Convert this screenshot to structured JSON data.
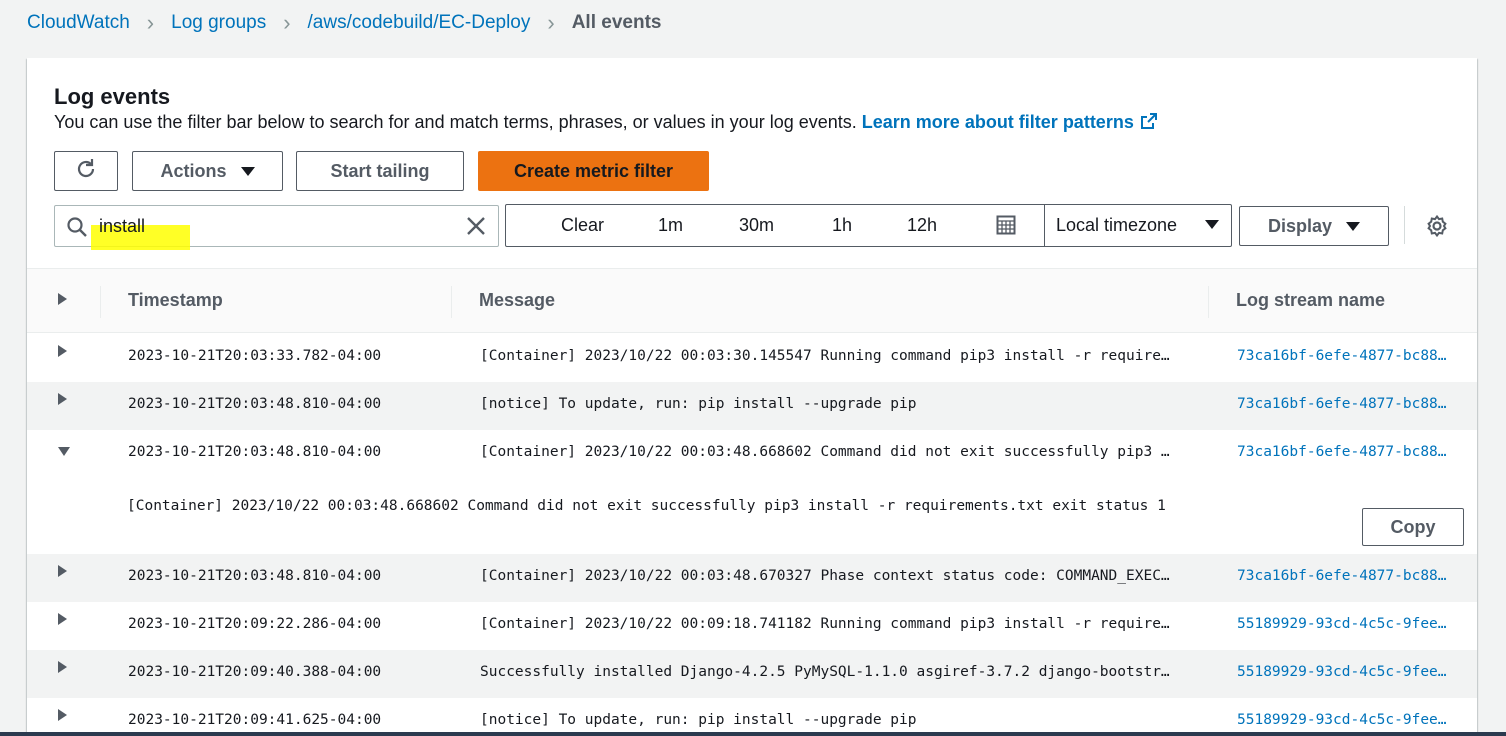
{
  "breadcrumb": {
    "items": [
      "CloudWatch",
      "Log groups",
      "/aws/codebuild/EC-Deploy"
    ],
    "current": "All events"
  },
  "panel": {
    "title": "Log events",
    "description": "You can use the filter bar below to search for and match terms, phrases, or values in your log events.",
    "learn_more": "Learn more about filter patterns"
  },
  "toolbar": {
    "actions_label": "Actions",
    "tailing_label": "Start tailing",
    "metric_label": "Create metric filter",
    "search_value": "install",
    "range": [
      "Clear",
      "1m",
      "30m",
      "1h",
      "12h"
    ],
    "timezone": "Local timezone",
    "display_label": "Display"
  },
  "columns": {
    "timestamp": "Timestamp",
    "message": "Message",
    "stream": "Log stream name"
  },
  "rows": [
    {
      "ts": "2023-10-21T20:03:33.782-04:00",
      "msg": "[Container] 2023/10/22 00:03:30.145547 Running command pip3 install -r require…",
      "stream": "73ca16bf-6efe-4877-bc88…"
    },
    {
      "ts": "2023-10-21T20:03:48.810-04:00",
      "msg": "[notice] To update, run: pip install --upgrade pip",
      "stream": "73ca16bf-6efe-4877-bc88…"
    },
    {
      "ts": "2023-10-21T20:03:48.810-04:00",
      "msg": "[Container] 2023/10/22 00:03:48.668602 Command did not exit successfully pip3 …",
      "stream": "73ca16bf-6efe-4877-bc88…"
    },
    {
      "ts": "2023-10-21T20:03:48.810-04:00",
      "msg": "[Container] 2023/10/22 00:03:48.670327 Phase context status code: COMMAND_EXEC…",
      "stream": "73ca16bf-6efe-4877-bc88…"
    },
    {
      "ts": "2023-10-21T20:09:22.286-04:00",
      "msg": "[Container] 2023/10/22 00:09:18.741182 Running command pip3 install -r require…",
      "stream": "55189929-93cd-4c5c-9fee…"
    },
    {
      "ts": "2023-10-21T20:09:40.388-04:00",
      "msg": "Successfully installed Django-4.2.5 PyMySQL-1.1.0 asgiref-3.7.2 django-bootstr…",
      "stream": "55189929-93cd-4c5c-9fee…"
    },
    {
      "ts": "2023-10-21T20:09:41.625-04:00",
      "msg": "[notice] To update, run: pip install --upgrade pip",
      "stream": "55189929-93cd-4c5c-9fee…"
    }
  ],
  "expanded": {
    "full_message": "[Container] 2023/10/22 00:03:48.668602 Command did not exit successfully pip3 install -r requirements.txt exit status 1",
    "copy_label": "Copy"
  },
  "icons": {
    "refresh": "refresh-icon",
    "search": "search-icon",
    "clear": "close-icon",
    "calendar": "calendar-icon",
    "settings": "gear-icon",
    "external": "external-link-icon"
  },
  "colors": {
    "link": "#0073bb",
    "primary_button": "#ec7211",
    "search_highlight": "#ffff00"
  }
}
